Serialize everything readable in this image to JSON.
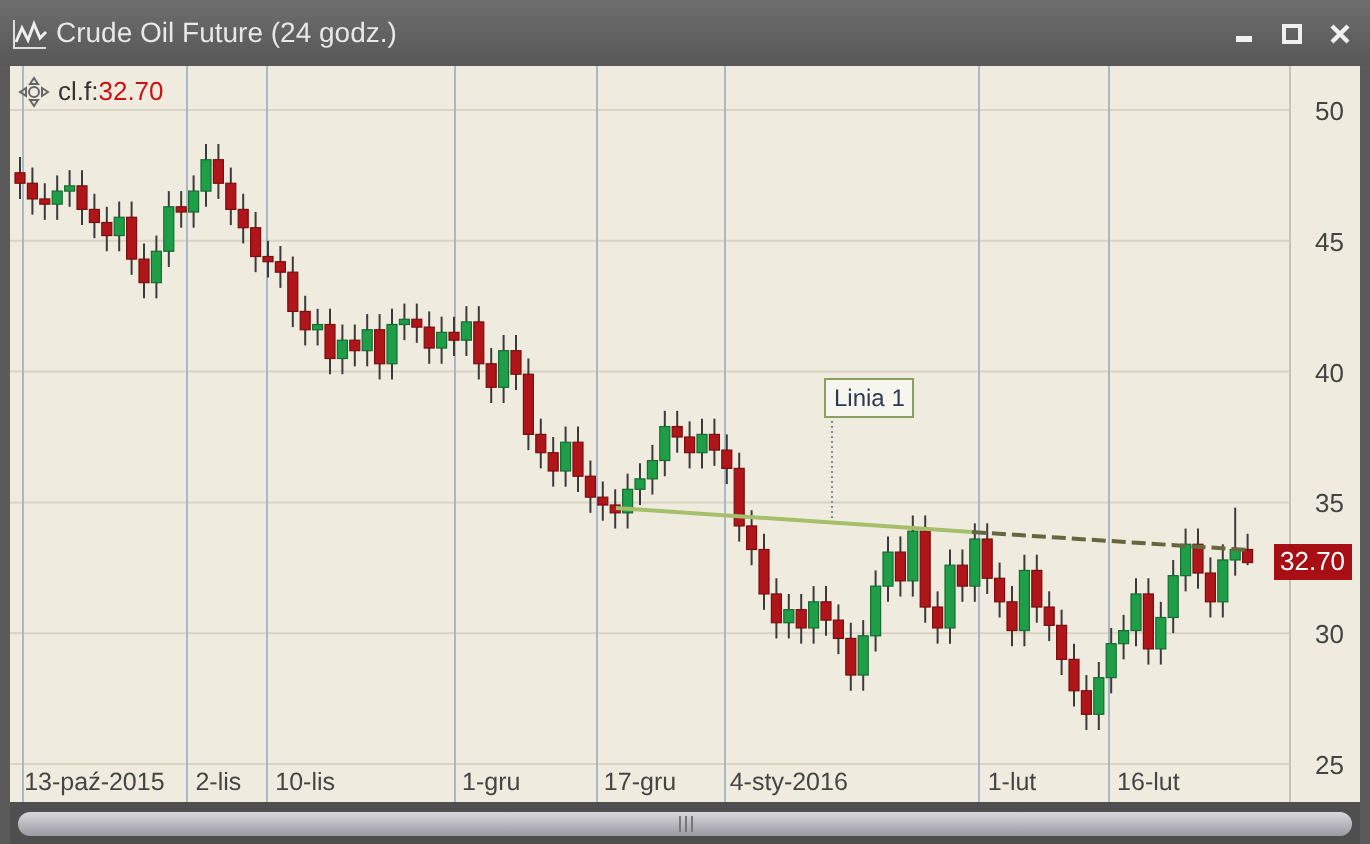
{
  "window": {
    "title": "Crude Oil Future (24 godz.)"
  },
  "legend": {
    "symbol": "cl.f:",
    "value": "32.70"
  },
  "chart_data": {
    "type": "candlestick",
    "grid": true,
    "ylim": [
      25,
      50
    ],
    "yticks": [
      25,
      30,
      35,
      40,
      45,
      50
    ],
    "categories": [
      null,
      null,
      null,
      null,
      null,
      null,
      "13-paź-2015",
      null,
      null,
      null,
      null,
      null,
      null,
      null,
      null,
      null,
      "2-lis",
      null,
      null,
      null,
      null,
      null,
      null,
      "10-lis",
      null,
      null,
      null,
      null,
      null,
      null,
      null,
      null,
      null,
      null,
      null,
      null,
      null,
      null,
      "1-gru",
      null,
      null,
      null,
      null,
      null,
      null,
      null,
      null,
      null,
      null,
      null,
      "17-gru",
      null,
      null,
      null,
      null,
      null,
      null,
      null,
      null,
      null,
      null,
      null,
      "4-sty-2016",
      null,
      null,
      null,
      null,
      null,
      null,
      null,
      null,
      null,
      null,
      null,
      null,
      null,
      null,
      null,
      null,
      null,
      "1-lut",
      null,
      null,
      null,
      null,
      null,
      null,
      null,
      null,
      null,
      null,
      "16-lut",
      null,
      null,
      null,
      null,
      null,
      null,
      null,
      null
    ],
    "ohlc": [
      [
        47.6,
        48.2,
        46.6,
        47.2
      ],
      [
        47.2,
        47.8,
        46.0,
        46.6
      ],
      [
        46.6,
        47.2,
        45.8,
        46.4
      ],
      [
        46.4,
        47.5,
        45.8,
        46.9
      ],
      [
        46.9,
        47.7,
        46.3,
        47.1
      ],
      [
        47.1,
        47.7,
        45.6,
        46.2
      ],
      [
        46.2,
        46.8,
        45.1,
        45.7
      ],
      [
        45.7,
        46.3,
        44.6,
        45.2
      ],
      [
        45.2,
        46.5,
        44.6,
        45.9
      ],
      [
        45.9,
        46.5,
        43.7,
        44.3
      ],
      [
        44.3,
        44.9,
        42.8,
        43.4
      ],
      [
        43.4,
        45.2,
        42.8,
        44.6
      ],
      [
        44.6,
        46.9,
        44.0,
        46.3
      ],
      [
        46.3,
        46.9,
        45.5,
        46.1
      ],
      [
        46.1,
        47.5,
        45.5,
        46.9
      ],
      [
        46.9,
        48.7,
        46.3,
        48.1
      ],
      [
        48.1,
        48.7,
        46.6,
        47.2
      ],
      [
        47.2,
        47.8,
        45.6,
        46.2
      ],
      [
        46.2,
        46.8,
        44.9,
        45.5
      ],
      [
        45.5,
        46.1,
        43.8,
        44.4
      ],
      [
        44.4,
        45.0,
        43.6,
        44.2
      ],
      [
        44.2,
        44.8,
        43.2,
        43.8
      ],
      [
        43.8,
        44.4,
        41.7,
        42.3
      ],
      [
        42.3,
        42.9,
        41.0,
        41.6
      ],
      [
        41.6,
        42.4,
        41.0,
        41.8
      ],
      [
        41.8,
        42.4,
        39.9,
        40.5
      ],
      [
        40.5,
        41.8,
        39.9,
        41.2
      ],
      [
        41.2,
        41.8,
        40.2,
        40.8
      ],
      [
        40.8,
        42.2,
        40.2,
        41.6
      ],
      [
        41.6,
        42.2,
        39.7,
        40.3
      ],
      [
        40.3,
        42.4,
        39.7,
        41.8
      ],
      [
        41.8,
        42.6,
        41.2,
        42.0
      ],
      [
        42.0,
        42.6,
        41.1,
        41.7
      ],
      [
        41.7,
        42.3,
        40.3,
        40.9
      ],
      [
        40.9,
        42.1,
        40.3,
        41.5
      ],
      [
        41.5,
        42.1,
        40.6,
        41.2
      ],
      [
        41.2,
        42.5,
        40.6,
        41.9
      ],
      [
        41.9,
        42.5,
        39.7,
        40.3
      ],
      [
        40.3,
        40.9,
        38.8,
        39.4
      ],
      [
        39.4,
        41.4,
        38.8,
        40.8
      ],
      [
        40.8,
        41.4,
        39.3,
        39.9
      ],
      [
        39.9,
        40.5,
        37.0,
        37.6
      ],
      [
        37.6,
        38.2,
        36.3,
        36.9
      ],
      [
        36.9,
        37.5,
        35.6,
        36.2
      ],
      [
        36.2,
        37.9,
        35.6,
        37.3
      ],
      [
        37.3,
        37.9,
        35.4,
        36.0
      ],
      [
        36.0,
        36.6,
        34.6,
        35.2
      ],
      [
        35.2,
        35.8,
        34.3,
        34.9
      ],
      [
        34.9,
        35.5,
        34.0,
        34.6
      ],
      [
        34.6,
        36.1,
        34.0,
        35.5
      ],
      [
        35.5,
        36.5,
        34.9,
        35.9
      ],
      [
        35.9,
        37.2,
        35.3,
        36.6
      ],
      [
        36.6,
        38.5,
        36.0,
        37.9
      ],
      [
        37.9,
        38.5,
        36.9,
        37.5
      ],
      [
        37.5,
        38.1,
        36.3,
        36.9
      ],
      [
        36.9,
        38.2,
        36.3,
        37.6
      ],
      [
        37.6,
        38.2,
        36.4,
        37.0
      ],
      [
        37.0,
        37.6,
        35.7,
        36.3
      ],
      [
        36.3,
        36.9,
        33.5,
        34.1
      ],
      [
        34.1,
        34.7,
        32.6,
        33.2
      ],
      [
        33.2,
        33.8,
        30.9,
        31.5
      ],
      [
        31.5,
        32.1,
        29.8,
        30.4
      ],
      [
        30.4,
        31.5,
        29.8,
        30.9
      ],
      [
        30.9,
        31.5,
        29.6,
        30.2
      ],
      [
        30.2,
        31.8,
        29.6,
        31.2
      ],
      [
        31.2,
        31.8,
        29.9,
        30.5
      ],
      [
        30.5,
        31.1,
        29.2,
        29.8
      ],
      [
        29.8,
        30.4,
        27.8,
        28.4
      ],
      [
        28.4,
        30.5,
        27.8,
        29.9
      ],
      [
        29.9,
        32.4,
        29.3,
        31.8
      ],
      [
        31.8,
        33.7,
        31.2,
        33.1
      ],
      [
        33.1,
        33.7,
        31.4,
        32.0
      ],
      [
        32.0,
        34.5,
        31.4,
        33.9
      ],
      [
        33.9,
        34.5,
        30.4,
        31.0
      ],
      [
        31.0,
        31.6,
        29.6,
        30.2
      ],
      [
        30.2,
        33.2,
        29.6,
        32.6
      ],
      [
        32.6,
        33.2,
        31.2,
        31.8
      ],
      [
        31.8,
        34.2,
        31.2,
        33.6
      ],
      [
        33.6,
        34.2,
        31.5,
        32.1
      ],
      [
        32.1,
        32.7,
        30.6,
        31.2
      ],
      [
        31.2,
        31.8,
        29.5,
        30.1
      ],
      [
        30.1,
        33.0,
        29.5,
        32.4
      ],
      [
        32.4,
        33.0,
        30.4,
        31.0
      ],
      [
        31.0,
        31.6,
        29.7,
        30.3
      ],
      [
        30.3,
        30.9,
        28.4,
        29.0
      ],
      [
        29.0,
        29.6,
        27.2,
        27.8
      ],
      [
        27.8,
        28.4,
        26.3,
        26.9
      ],
      [
        26.9,
        28.9,
        26.3,
        28.3
      ],
      [
        28.3,
        30.2,
        27.7,
        29.6
      ],
      [
        29.6,
        30.7,
        29.0,
        30.1
      ],
      [
        30.1,
        32.1,
        29.5,
        31.5
      ],
      [
        31.5,
        32.1,
        28.8,
        29.4
      ],
      [
        29.4,
        31.2,
        28.8,
        30.6
      ],
      [
        30.6,
        32.8,
        30.0,
        32.2
      ],
      [
        32.2,
        34.0,
        31.6,
        33.4
      ],
      [
        33.4,
        34.0,
        31.7,
        32.3
      ],
      [
        32.3,
        32.9,
        30.6,
        31.2
      ],
      [
        31.2,
        33.4,
        30.6,
        32.8
      ],
      [
        32.8,
        34.8,
        32.2,
        33.2
      ],
      [
        33.2,
        33.8,
        32.6,
        32.7
      ]
    ],
    "annotations": [
      "Linia 1",
      "32.70"
    ]
  }
}
